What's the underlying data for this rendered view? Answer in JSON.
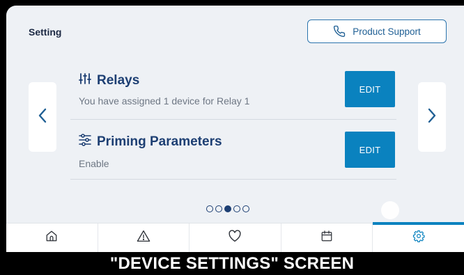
{
  "header": {
    "title": "Setting",
    "support_label": "Product Support",
    "support_icon": "phone-icon"
  },
  "settings": [
    {
      "title": "Relays",
      "subtitle": "You have assigned 1 device for Relay 1",
      "action_label": "EDIT",
      "icon": "sliders-icon"
    },
    {
      "title": "Priming Parameters",
      "subtitle": "Enable",
      "action_label": "EDIT",
      "icon": "filter-settings-icon"
    }
  ],
  "pagination": {
    "total": 5,
    "current": 3
  },
  "tabs": [
    {
      "icon": "home-icon",
      "active": false
    },
    {
      "icon": "warning-icon",
      "active": false
    },
    {
      "icon": "heart-icon",
      "active": false
    },
    {
      "icon": "calendar-icon",
      "active": false
    },
    {
      "icon": "gear-icon",
      "active": true
    }
  ],
  "caption": "\"DEVICE SETTINGS\" SCREEN",
  "colors": {
    "accent": "#0a82bf",
    "title_text": "#1d3f73",
    "background": "#eef1f5"
  }
}
